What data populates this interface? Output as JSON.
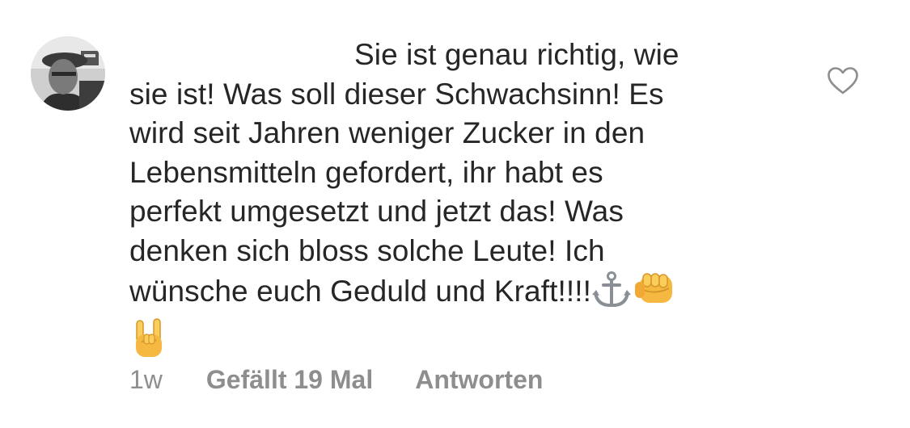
{
  "comment": {
    "avatar_icon": "user-avatar",
    "lines": [
      "Sie ist genau richtig, wie",
      "sie ist! Was soll dieser Schwachsinn! Es",
      "wird seit Jahren weniger Zucker in den",
      "Lebensmitteln gefordert, ihr habt es",
      "perfekt umgesetzt und jetzt das! Was",
      "denken sich bloss solche Leute! Ich",
      "wünsche euch Geduld und Kraft!!!!"
    ],
    "emojis": [
      "anchor-emoji",
      "fist-emoji",
      "rock-hand-emoji"
    ],
    "like_icon": "heart-outline-icon",
    "meta": {
      "time": "1w",
      "likes": "Gefällt 19 Mal",
      "reply": "Antworten"
    }
  }
}
